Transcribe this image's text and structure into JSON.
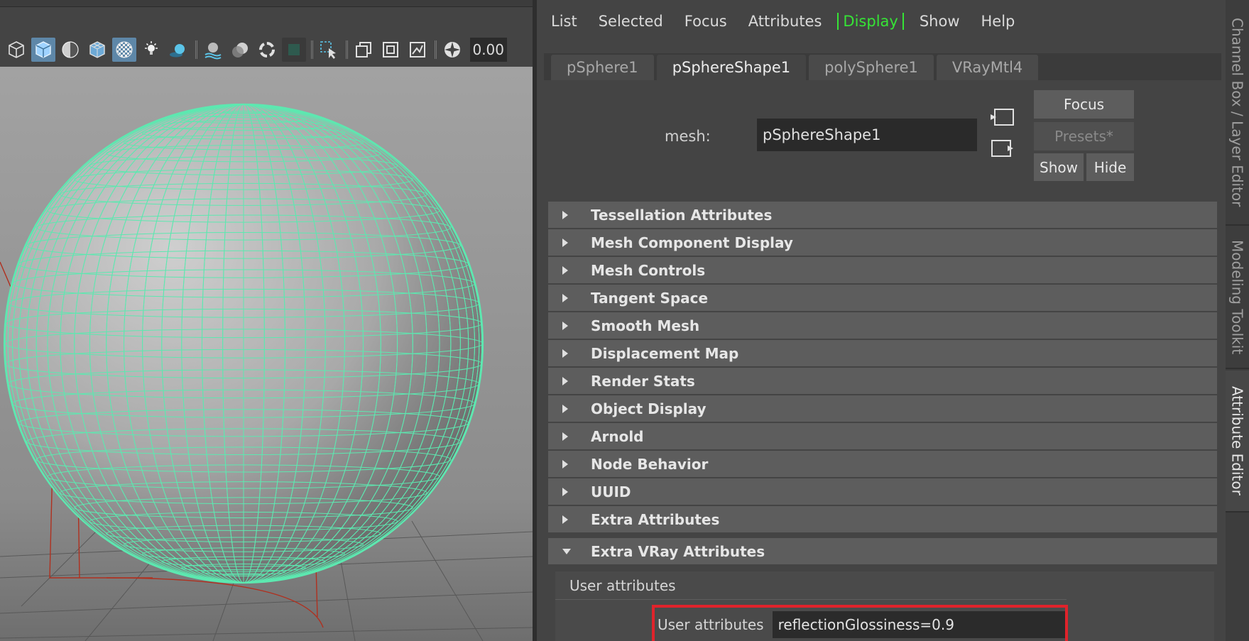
{
  "viewport": {
    "toolbar_icons": [
      "wireframe-cube-icon",
      "shaded-cube-icon",
      "textured-sphere-icon",
      "wire-on-shaded-icon",
      "xray-checker-icon",
      "light-bulb-icon",
      "shadow-sphere-icon",
      "ambient-occlusion-icon",
      "motion-blur-icon",
      "anti-alias-icon",
      "depth-of-field-icon",
      "isolate-select-icon",
      "select-arrow-icon",
      "grid-toggle-icon",
      "film-gate-icon",
      "resolution-gate-icon",
      "camera-attributes-icon",
      "exposure-icon"
    ],
    "exposure_value": "0.00"
  },
  "menubar": [
    "List",
    "Selected",
    "Focus",
    "Attributes",
    "Display",
    "Show",
    "Help"
  ],
  "menubar_active": "Display",
  "tabs": [
    "pSphere1",
    "pSphereShape1",
    "polySphere1",
    "VRayMtl4"
  ],
  "active_tab": "pSphereShape1",
  "mesh": {
    "label": "mesh:",
    "value": "pSphereShape1"
  },
  "buttons": {
    "focus": "Focus",
    "presets": "Presets*",
    "show": "Show",
    "hide": "Hide"
  },
  "sections": [
    "Tessellation Attributes",
    "Mesh Component Display",
    "Mesh Controls",
    "Tangent Space",
    "Smooth Mesh",
    "Displacement Map",
    "Render Stats",
    "Object Display",
    "Arnold",
    "Node Behavior",
    "UUID",
    "Extra Attributes"
  ],
  "open_section": "Extra VRay Attributes",
  "user_attributes": {
    "header": "User attributes",
    "label": "User attributes",
    "value": "reflectionGlossiness=0.9"
  },
  "side_tabs": [
    "Channel Box / Layer Editor",
    "Modeling Toolkit",
    "Attribute Editor"
  ],
  "colors": {
    "accent_green": "#36e436",
    "wire_green": "#5de8b0",
    "highlight_red": "#e0232b",
    "selected_blue": "#5e87a8"
  }
}
